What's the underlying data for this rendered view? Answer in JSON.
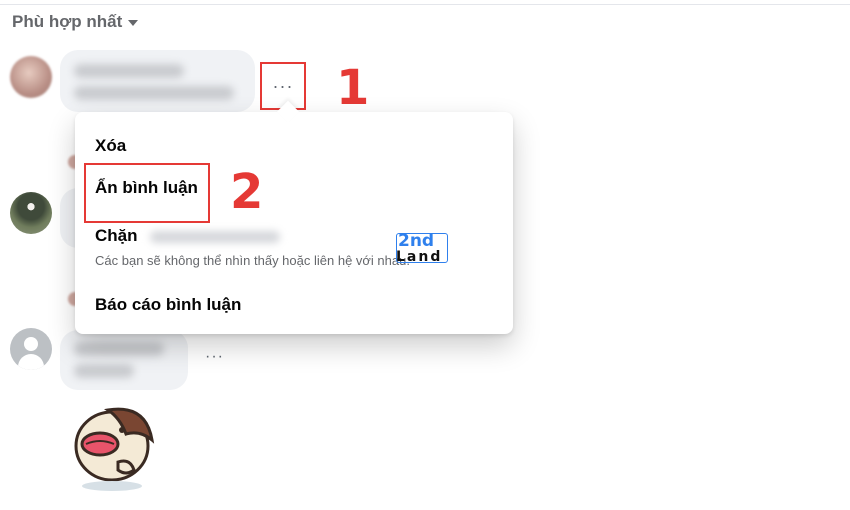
{
  "sort": {
    "label": "Phù hợp nhất"
  },
  "more_button": {
    "label": "···"
  },
  "comment3_more": {
    "label": "···"
  },
  "steps": {
    "one": "1",
    "two": "2"
  },
  "menu": {
    "delete": "Xóa",
    "hide": "Ẩn bình luận",
    "block": "Chặn",
    "block_subtitle": "Các bạn sẽ không thể nhìn thấy hoặc liên hệ với nhau.",
    "report": "Báo cáo bình luận"
  },
  "watermark": {
    "top": "2nd",
    "bottom": "Land"
  },
  "colors": {
    "highlight": "#e53935",
    "muted_text": "#65676b",
    "bubble": "#f0f2f5"
  },
  "icons": [
    "chevron-down-icon",
    "more-dots-icon",
    "default-avatar-icon",
    "sticker-icon"
  ]
}
